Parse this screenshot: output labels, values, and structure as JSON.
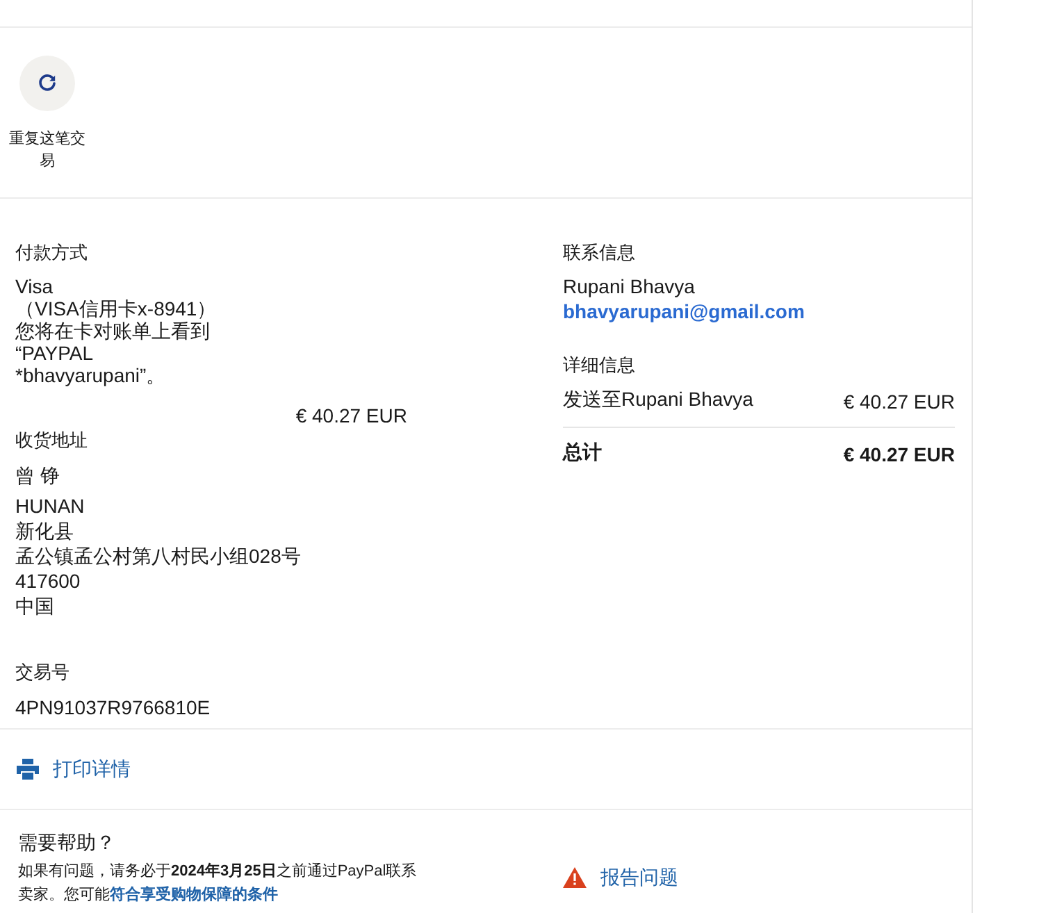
{
  "repeat_action": {
    "label": "重复这笔交易"
  },
  "payment": {
    "heading": "付款方式",
    "lines": [
      "Visa",
      "（VISA信用卡x-8941）",
      "您将在卡对账单上看到",
      "“PAYPAL",
      "*bhavyarupani”。"
    ],
    "amount": "€ 40.27 EUR"
  },
  "shipping": {
    "heading": "收货地址",
    "name": "曾 铮",
    "address_lines": [
      "HUNAN",
      "新化县",
      "孟公镇孟公村第八村民小组028号",
      "417600",
      "中国"
    ]
  },
  "transaction": {
    "heading": "交易号",
    "id": "4PN91037R9766810E"
  },
  "contact": {
    "heading": "联系信息",
    "name": "Rupani Bhavya",
    "email": "bhavyarupani@gmail.com"
  },
  "details": {
    "heading": "详细信息",
    "items": [
      {
        "label": "发送至Rupani Bhavya",
        "amount": "€ 40.27 EUR"
      }
    ],
    "total": {
      "label": "总计",
      "amount": "€ 40.27 EUR"
    }
  },
  "print": {
    "label": "打印详情"
  },
  "help": {
    "title": "需要帮助？",
    "text": "如果有问题，请务必于**2024年3月25日**之前通过PayPal联系卖家。您可能",
    "link": "符合享受购物保障的条件"
  },
  "report": {
    "label": "报告问题"
  }
}
